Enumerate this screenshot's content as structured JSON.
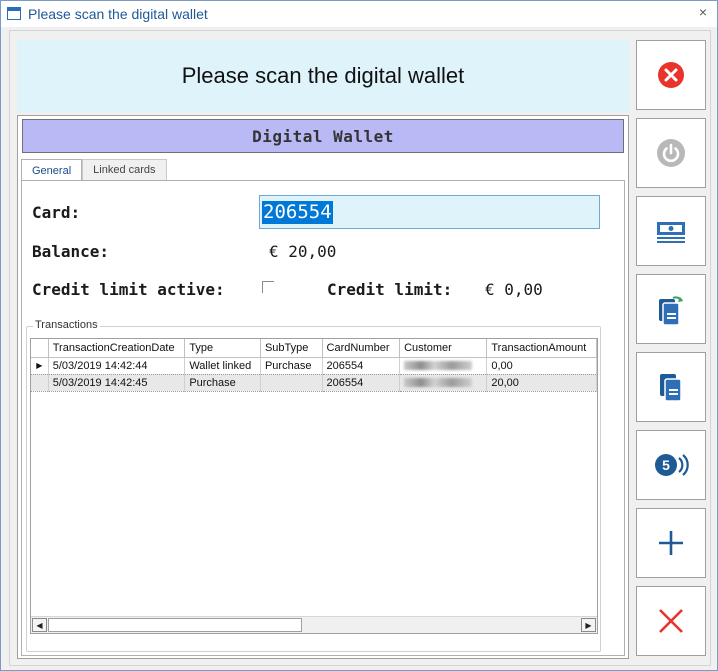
{
  "window": {
    "title": "Please scan the digital wallet"
  },
  "banner": {
    "text": "Please scan the digital wallet"
  },
  "wallet": {
    "header": "Digital Wallet"
  },
  "tabs": [
    {
      "label": "General"
    },
    {
      "label": "Linked cards"
    }
  ],
  "form": {
    "card_label": "Card:",
    "card_value": "206554",
    "balance_label": "Balance:",
    "balance_value": "€ 20,00",
    "credit_active_label": "Credit limit active:",
    "credit_limit_label": "Credit limit:",
    "credit_limit_value": "€ 0,00"
  },
  "transactions": {
    "title": "Transactions",
    "columns": [
      "TransactionCreationDate",
      "Type",
      "SubType",
      "CardNumber",
      "Customer",
      "TransactionAmount"
    ],
    "rows": [
      {
        "date": "5/03/2019 14:42:44",
        "type": "Wallet linked",
        "subtype": "Purchase",
        "card": "206554",
        "amount": "0,00"
      },
      {
        "date": "5/03/2019 14:42:45",
        "type": "Purchase",
        "subtype": "",
        "card": "206554",
        "amount": "20,00"
      }
    ]
  },
  "colors": {
    "accent": "#0078d7",
    "banner_bg": "#dff3fb",
    "header_bg": "#b9b9f5",
    "danger": "#e8342b",
    "icon_blue": "#2e6fb7"
  },
  "buttons": [
    {
      "name": "cancel-button",
      "icon": "cancel-circle-icon"
    },
    {
      "name": "power-button",
      "icon": "power-icon"
    },
    {
      "name": "cash-button",
      "icon": "cash-icon"
    },
    {
      "name": "transfer-button",
      "icon": "transfer-cards-icon"
    },
    {
      "name": "copy-button",
      "icon": "copy-cards-icon"
    },
    {
      "name": "contactless-button",
      "icon": "contactless-coin-icon"
    },
    {
      "name": "add-button",
      "icon": "plus-icon"
    },
    {
      "name": "close-button",
      "icon": "close-x-icon"
    }
  ]
}
